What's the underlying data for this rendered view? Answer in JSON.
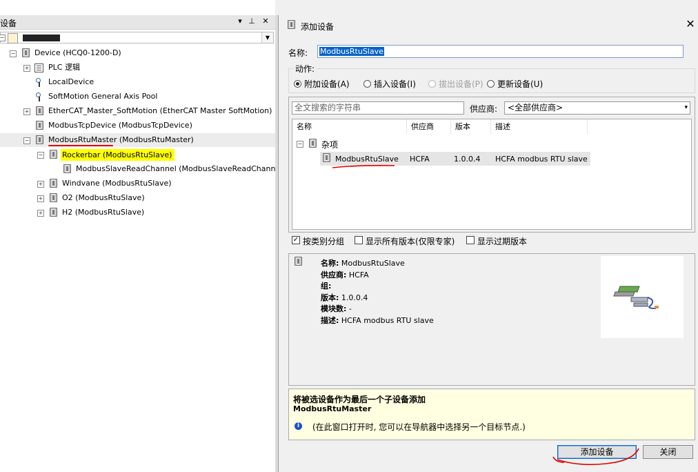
{
  "left_panel": {
    "title": "设备",
    "pin_icon": "pin-icon",
    "close_icon": "close-icon",
    "root_label": "",
    "tree": [
      {
        "id": "device",
        "label": "Device (HCQ0-1200-D)"
      },
      {
        "id": "plc",
        "label": "PLC 逻辑"
      },
      {
        "id": "local",
        "label": "LocalDevice"
      },
      {
        "id": "softmotion",
        "label": "SoftMotion General Axis Pool"
      },
      {
        "id": "ethercat",
        "label": "EtherCAT_Master_SoftMotion (EtherCAT Master SoftMotion)"
      },
      {
        "id": "modbustcp",
        "label": "ModbusTcpDevice (ModbusTcpDevice)"
      },
      {
        "id": "modbusrtu",
        "label": "ModbusRtuMaster (ModbusRtuMaster)"
      },
      {
        "id": "rockerbar",
        "label": "Rockerbar (ModbusRtuSlave)"
      },
      {
        "id": "readchannel",
        "label": "ModbusSlaveReadChannel (ModbusSlaveReadChannel)"
      },
      {
        "id": "windvane",
        "label": "Windvane (ModbusRtuSlave)"
      },
      {
        "id": "o2",
        "label": "O2 (ModbusRtuSlave)"
      },
      {
        "id": "h2",
        "label": "H2 (ModbusRtuSlave)"
      }
    ]
  },
  "dialog": {
    "title": "添加设备",
    "name_label": "名称:",
    "name_value": "ModbusRtuSlave",
    "action_label": "动作:",
    "actions": [
      "附加设备(A)",
      "插入设备(I)",
      "拔出设备(P)",
      "更新设备(U)"
    ],
    "search_placeholder": "全文搜索的字符串",
    "vendor_label": "供应商:",
    "vendor_value": "<全部供应商>",
    "columns": [
      "名称",
      "供应商",
      "版本",
      "描述"
    ],
    "category": "杂项",
    "item": {
      "name": "ModbusRtuSlave",
      "vendor": "HCFA",
      "version": "1.0.0.4",
      "description": "HCFA modbus RTU slave"
    },
    "checkboxes": [
      {
        "label": "按类别分组",
        "checked": true
      },
      {
        "label": "显示所有版本(仅限专家)",
        "checked": false
      },
      {
        "label": "显示过期版本",
        "checked": false
      }
    ],
    "info": {
      "name_key": "名称:",
      "name_val": "ModbusRtuSlave",
      "vendor_key": "供应商:",
      "vendor_val": "HCFA",
      "group_key": "组:",
      "group_val": "",
      "version_key": "版本:",
      "version_val": "1.0.0.4",
      "modules_key": "模块数:",
      "modules_val": "-",
      "desc_key": "描述:",
      "desc_val": "HCFA modbus RTU slave"
    },
    "hint": {
      "line1": "将被选设备作为最后一个子设备添加",
      "line2": "ModbusRtuMaster",
      "line3": "(在此窗口打开时, 您可以在导航器中选择另一个目标节点.)"
    },
    "add_button": "添加设备",
    "close_button": "关闭"
  },
  "colors": {
    "highlight": "#ffff00",
    "annotation": "#e00000",
    "selection": "#0a64c8"
  }
}
